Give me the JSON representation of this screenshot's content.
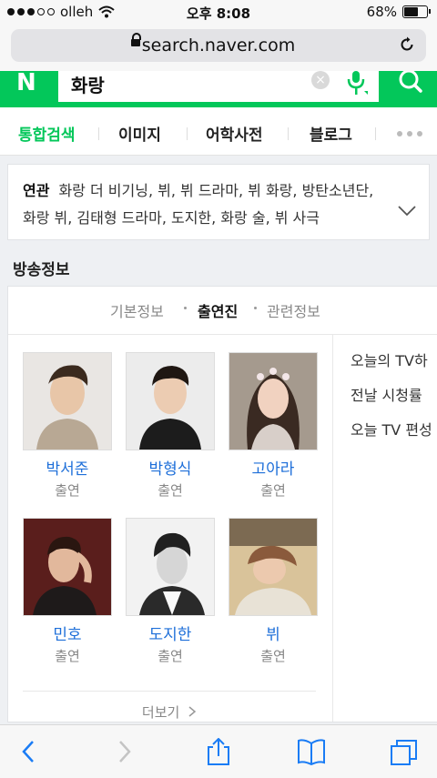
{
  "status": {
    "carrier": "olleh",
    "time": "오후 8:08",
    "battery": "68%",
    "battery_level": 0.68
  },
  "browser": {
    "url": "search.naver.com"
  },
  "search": {
    "logo": "N",
    "query": "화랑"
  },
  "tabs": [
    "통합검색",
    "이미지",
    "어학사전",
    "블로그"
  ],
  "related": {
    "label": "연관",
    "text": "화랑 더 비기닝, 뷔, 뷔 드라마, 뷔 화랑, 방탄소년단, 화랑 뷔, 김태형 드라마, 도지한, 화랑 술, 뷔 사극"
  },
  "broadcast": {
    "section_title": "방송정보",
    "subtabs": [
      "기본정보",
      "출연진",
      "관련정보"
    ],
    "active_subtab": "출연진",
    "cast": [
      {
        "name": "박서준",
        "role": "출연"
      },
      {
        "name": "박형식",
        "role": "출연"
      },
      {
        "name": "고아라",
        "role": "출연"
      },
      {
        "name": "민호",
        "role": "출연"
      },
      {
        "name": "도지한",
        "role": "출연"
      },
      {
        "name": "뷔",
        "role": "출연"
      }
    ],
    "more_label": "더보기",
    "side_items": [
      "오늘의 TV하",
      "전날 시청률",
      "오늘 TV 편성"
    ]
  },
  "colors": {
    "naver_green": "#03c75a",
    "link_blue": "#1e6fd9"
  },
  "toolbar": {
    "icons": [
      "back-icon",
      "forward-icon",
      "share-icon",
      "bookmarks-icon",
      "tabs-icon"
    ]
  }
}
